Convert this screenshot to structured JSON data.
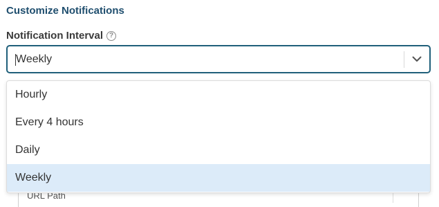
{
  "section": {
    "title": "Customize Notifications"
  },
  "interval_field": {
    "label": "Notification Interval",
    "help_icon": "question-circle-icon",
    "value": "Weekly",
    "options": [
      "Hourly",
      "Every 4 hours",
      "Daily",
      "Weekly"
    ],
    "selected_option": "Weekly"
  },
  "behind_field": {
    "value": "URL Path"
  },
  "colors": {
    "title": "#1f4e6e",
    "focus_border": "#1f5f7a",
    "selected_option_bg": "#dcebf9"
  }
}
